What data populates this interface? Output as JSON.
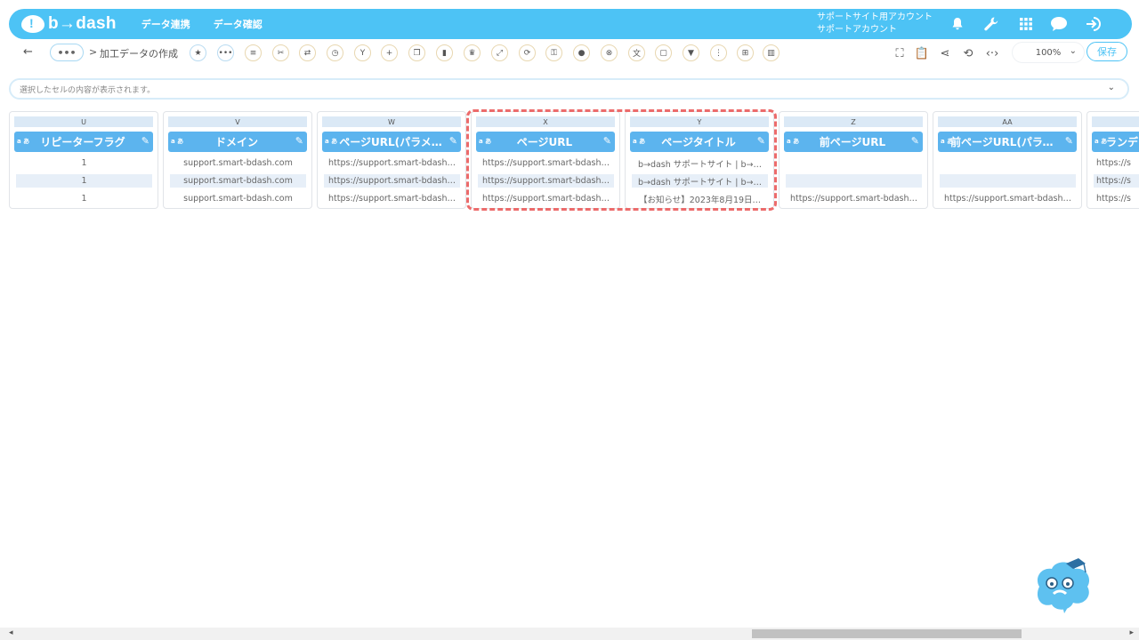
{
  "header": {
    "logo_text": "b→dash",
    "nav": [
      "データ連携",
      "データ確認"
    ],
    "account_line1": "サポートサイト用アカウント",
    "account_line2": "サポートアカウント",
    "icons": [
      "bell-icon",
      "wrench-icon",
      "grid-icon",
      "chat-icon",
      "logout-icon"
    ]
  },
  "toolbar": {
    "back": "←",
    "breadcrumb_dots": "•••",
    "breadcrumb_sep": ">",
    "title": "加工データの作成",
    "tools": [
      "star-icon",
      "more-icon",
      "list-icon",
      "scissors-icon",
      "swap-icon",
      "timer-icon",
      "merge-icon",
      "plus-icon",
      "copy-icon",
      "trash-icon",
      "crown-icon",
      "expand-icon",
      "repeat-icon",
      "lock-icon",
      "bag-icon",
      "cancel-icon",
      "translate-icon",
      "frame-icon",
      "filter-icon",
      "split-icon",
      "table-icon",
      "column-icon"
    ],
    "zoom": "100%",
    "save": "保存"
  },
  "cellbar": {
    "placeholder": "選択したセルの内容が表示されます。"
  },
  "columns": [
    {
      "letter": "U",
      "header": "リピーターフラグ",
      "cells": [
        "1",
        "1",
        "1"
      ]
    },
    {
      "letter": "V",
      "header": "ドメイン",
      "cells": [
        "support.smart-bdash.com",
        "support.smart-bdash.com",
        "support.smart-bdash.com"
      ]
    },
    {
      "letter": "W",
      "header": "ページURL(パラメ…",
      "cells": [
        "https://support.smart-bdash…",
        "https://support.smart-bdash…",
        "https://support.smart-bdash…"
      ]
    },
    {
      "letter": "X",
      "header": "ページURL",
      "cells": [
        "https://support.smart-bdash…",
        "https://support.smart-bdash…",
        "https://support.smart-bdash…"
      ]
    },
    {
      "letter": "Y",
      "header": "ページタイトル",
      "cells": [
        "b→dash サポートサイト | b→…",
        "b→dash サポートサイト | b→…",
        "【お知らせ】2023年8月19日…"
      ]
    },
    {
      "letter": "Z",
      "header": "前ページURL",
      "cells": [
        "",
        "",
        "https://support.smart-bdash…"
      ]
    },
    {
      "letter": "AA",
      "header": "前ページURL(パラメ…",
      "cells": [
        "",
        "",
        "https://support.smart-bdash…"
      ]
    },
    {
      "letter": "",
      "header": "ランデ",
      "cells": [
        "https://s",
        "https://s",
        "https://s"
      ]
    }
  ],
  "type_badge": "a あ",
  "colors": {
    "accent": "#4dc3f5",
    "header_blue": "#5cb4ee",
    "highlight": "#ec6b6b"
  }
}
